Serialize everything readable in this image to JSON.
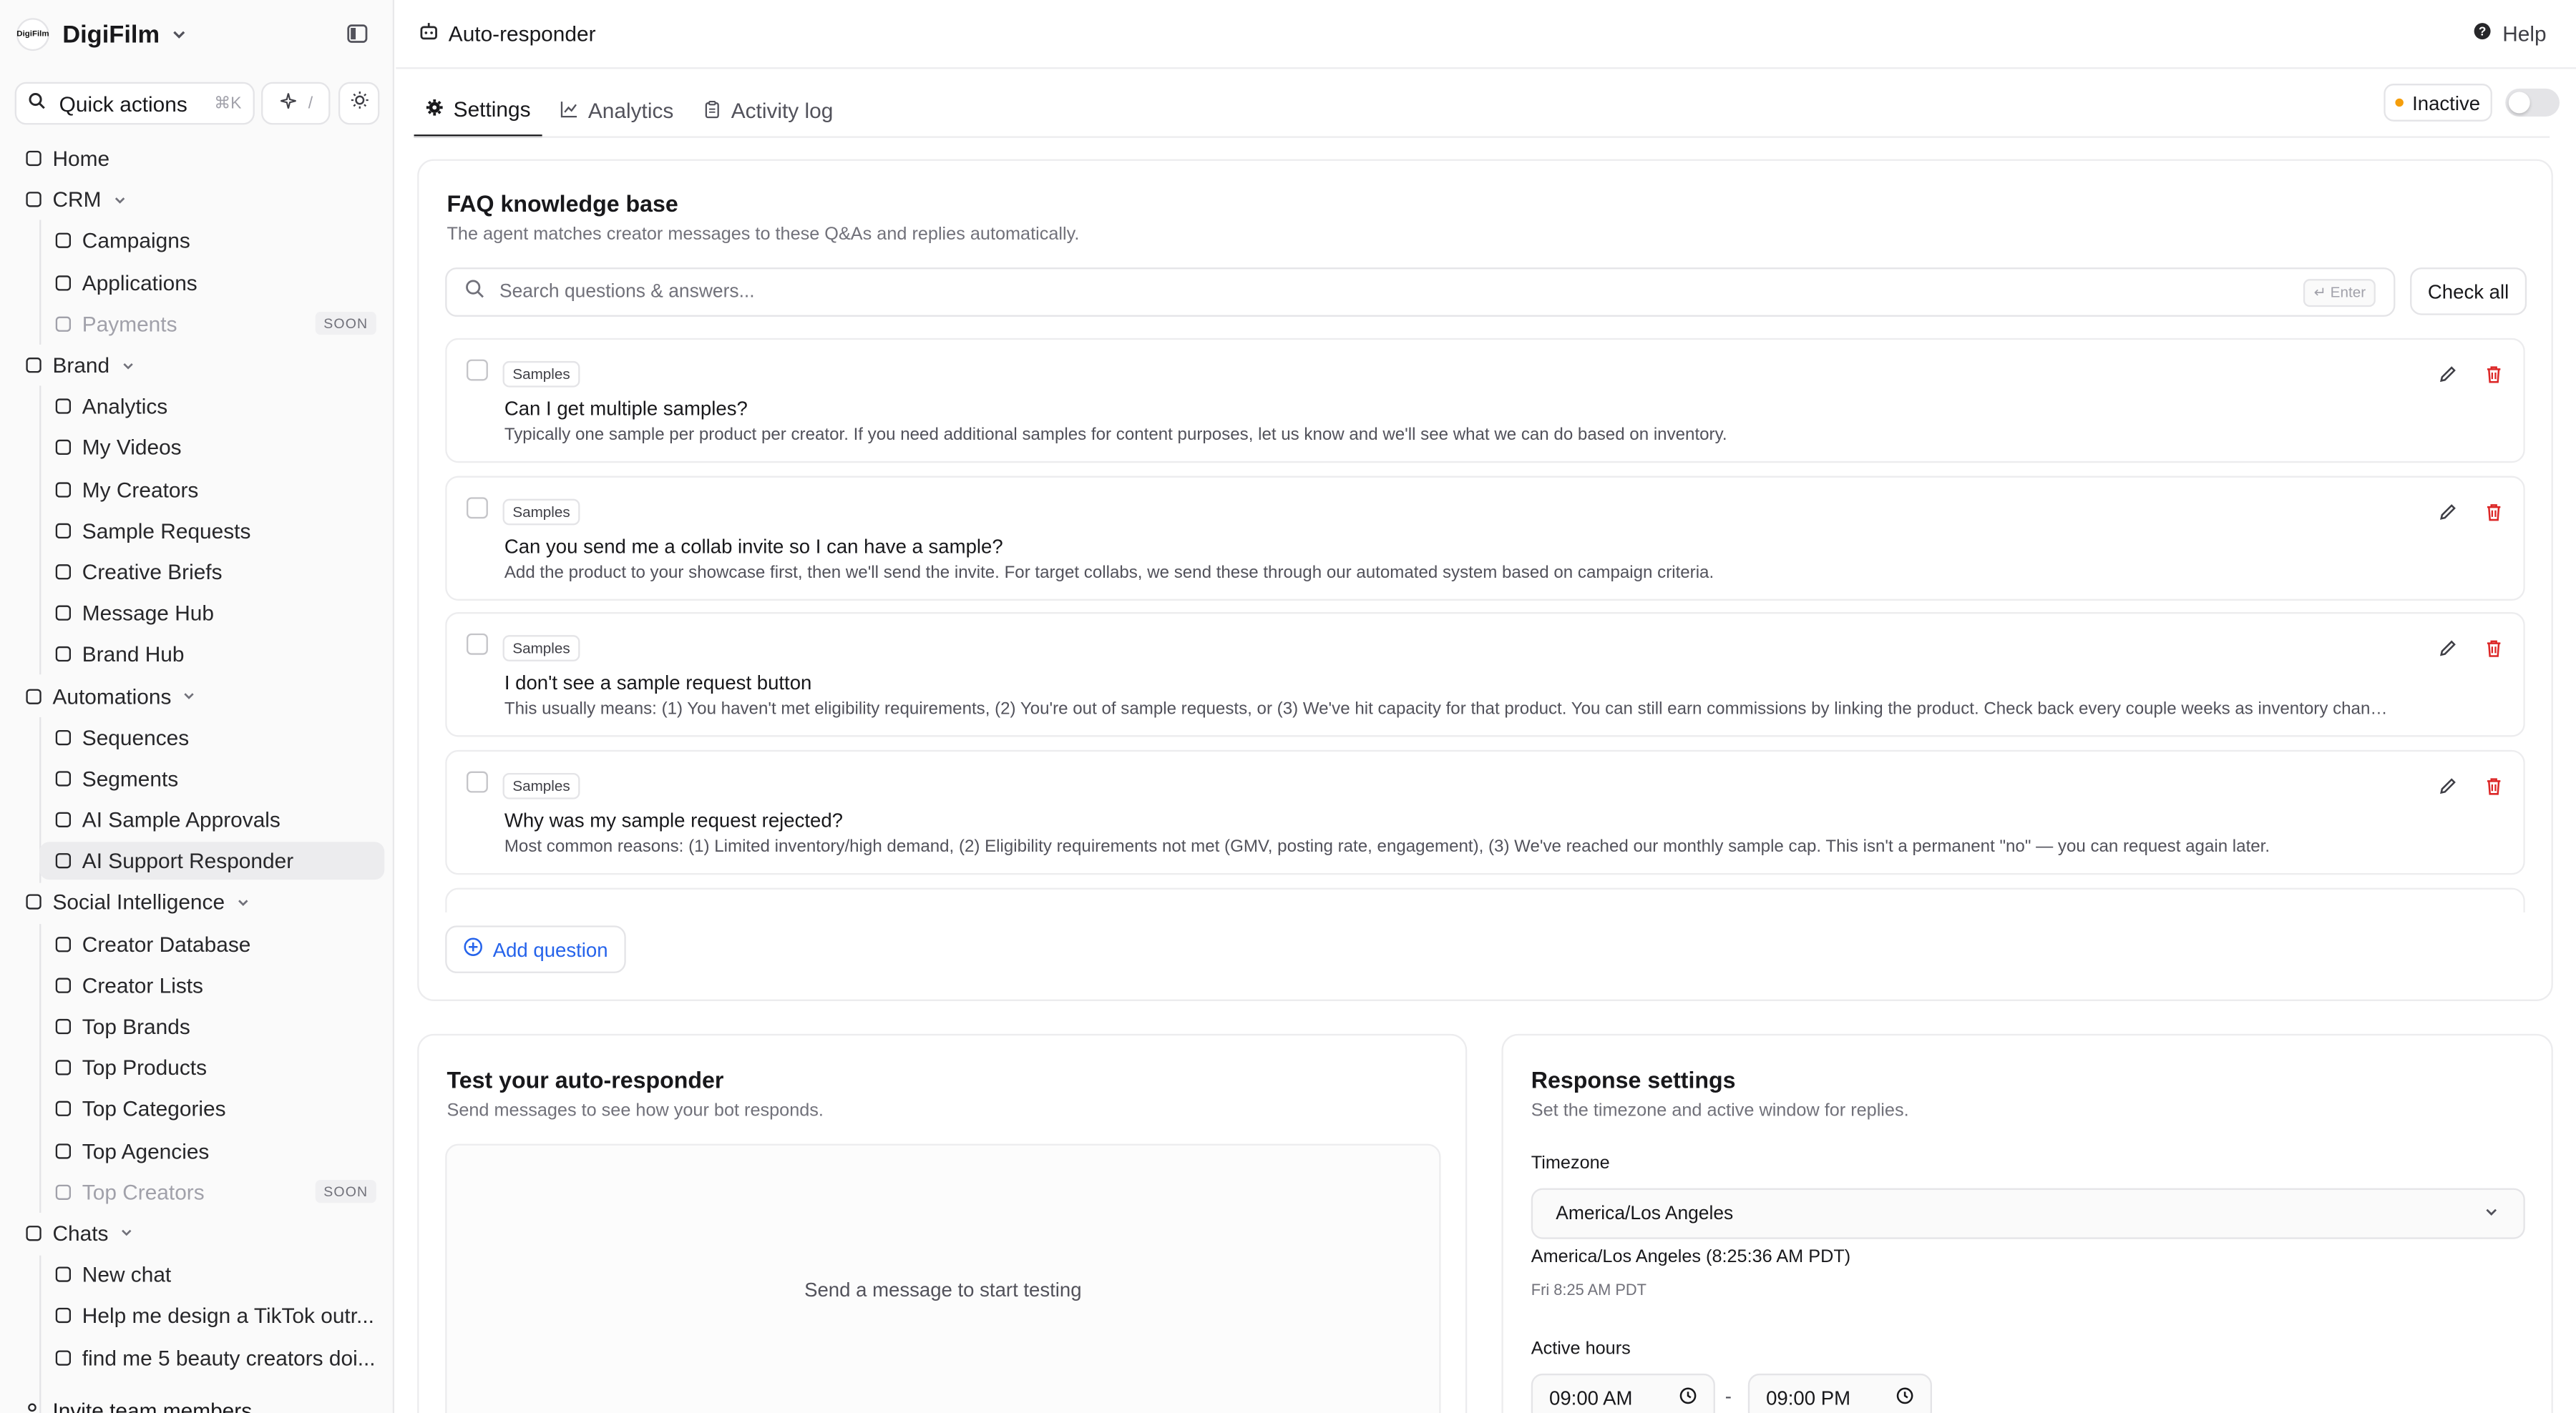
{
  "sidebar": {
    "logo_text": "DigiFilm",
    "brand": "DigiFilm",
    "quick_actions": {
      "label": "Quick actions",
      "shortcut": "⌘K",
      "slash": "/"
    },
    "nav": [
      {
        "label": "Home",
        "level": "top",
        "icon": "home-icon"
      },
      {
        "label": "CRM",
        "level": "top",
        "icon": "crm-icon",
        "chevron": true
      },
      {
        "label": "Campaigns",
        "level": "sub",
        "icon": "megaphone-icon"
      },
      {
        "label": "Applications",
        "level": "sub",
        "icon": "clipboard-icon"
      },
      {
        "label": "Payments",
        "level": "sub",
        "icon": "credit-card-icon",
        "badge": "SOON",
        "disabled": true
      },
      {
        "label": "Brand",
        "level": "top",
        "icon": "book-icon",
        "chevron": true
      },
      {
        "label": "Analytics",
        "level": "sub",
        "icon": "chart-line-icon"
      },
      {
        "label": "My Videos",
        "level": "sub",
        "icon": "video-icon"
      },
      {
        "label": "My Creators",
        "level": "sub",
        "icon": "users-icon"
      },
      {
        "label": "Sample Requests",
        "level": "sub",
        "icon": "gift-icon"
      },
      {
        "label": "Creative Briefs",
        "level": "sub",
        "icon": "file-icon"
      },
      {
        "label": "Message Hub",
        "level": "sub",
        "icon": "message-icon"
      },
      {
        "label": "Brand Hub",
        "level": "sub",
        "icon": "database-icon"
      },
      {
        "label": "Automations",
        "level": "top",
        "icon": "zap-icon",
        "chevron": true
      },
      {
        "label": "Sequences",
        "level": "sub",
        "icon": "send-icon"
      },
      {
        "label": "Segments",
        "level": "sub",
        "icon": "filter-icon"
      },
      {
        "label": "AI Sample Approvals",
        "level": "sub",
        "icon": "package-icon"
      },
      {
        "label": "AI Support Responder",
        "level": "sub",
        "icon": "bot-icon",
        "active": true
      },
      {
        "label": "Social Intelligence",
        "level": "top",
        "icon": "trending-icon",
        "chevron": true
      },
      {
        "label": "Creator Database",
        "level": "sub",
        "icon": "user-search-icon"
      },
      {
        "label": "Creator Lists",
        "level": "sub",
        "icon": "list-icon"
      },
      {
        "label": "Top Brands",
        "level": "sub",
        "icon": "store-icon"
      },
      {
        "label": "Top Products",
        "level": "sub",
        "icon": "bag-icon"
      },
      {
        "label": "Top Categories",
        "level": "sub",
        "icon": "layers-icon"
      },
      {
        "label": "Top Agencies",
        "level": "sub",
        "icon": "building-icon"
      },
      {
        "label": "Top Creators",
        "level": "sub",
        "icon": "bulb-icon",
        "badge": "SOON",
        "disabled": true
      },
      {
        "label": "Chats",
        "level": "top",
        "icon": "chats-icon",
        "chevron": true
      },
      {
        "label": "New chat",
        "level": "sub",
        "icon": "plus-icon"
      },
      {
        "label": "Help me design a TikTok outr...",
        "level": "sub",
        "icon": "message-icon"
      },
      {
        "label": "find me 5 beauty creators doi...",
        "level": "sub",
        "icon": "message-icon"
      }
    ],
    "invite": "Invite team members"
  },
  "header": {
    "title": "Auto-responder",
    "help": "Help"
  },
  "tabs": [
    {
      "label": "Settings",
      "icon": "gear-icon",
      "active": true
    },
    {
      "label": "Analytics",
      "icon": "chart-line-icon"
    },
    {
      "label": "Activity log",
      "icon": "clipboard-icon"
    }
  ],
  "status": {
    "label": "Inactive",
    "dot_color": "#f59e0b",
    "enabled": false
  },
  "faq": {
    "title": "FAQ knowledge base",
    "subtitle": "The agent matches creator messages to these Q&As and replies automatically.",
    "search_placeholder": "Search questions & answers...",
    "enter_hint": "↵ Enter",
    "check_all": "Check all",
    "items": [
      {
        "category": "Samples",
        "question": "Can I get multiple samples?",
        "answer": "Typically one sample per product per creator. If you need additional samples for content purposes, let us know and we'll see what we can do based on inventory."
      },
      {
        "category": "Samples",
        "question": "Can you send me a collab invite so I can have a sample?",
        "answer": "Add the product to your showcase first, then we'll send the invite. For target collabs, we send these through our automated system based on campaign criteria."
      },
      {
        "category": "Samples",
        "question": "I don't see a sample request button",
        "answer": "This usually means: (1) You haven't met eligibility requirements, (2) You're out of sample requests, or (3) We've hit capacity for that product. You can still earn commissions by linking the product. Check back every couple weeks as inventory changes."
      },
      {
        "category": "Samples",
        "question": "Why was my sample request rejected?",
        "answer": "Most common reasons: (1) Limited inventory/high demand, (2) Eligibility requirements not met (GMV, posting rate, engagement), (3) We've reached our monthly sample cap. This isn't a permanent \"no\" — you can request again later."
      }
    ],
    "add_question": "Add question"
  },
  "test": {
    "title": "Test your auto-responder",
    "subtitle": "Send messages to see how your bot responds.",
    "placeholder": "Send a message to start testing"
  },
  "response": {
    "title": "Response settings",
    "subtitle": "Set the timezone and active window for replies.",
    "timezone_label": "Timezone",
    "timezone_value": "America/Los Angeles",
    "timezone_now": "America/Los Angeles (8:25:36 AM PDT)",
    "timezone_sub": "Fri 8:25 AM PDT",
    "active_hours_label": "Active hours",
    "start": "09:00 AM",
    "separator": "-",
    "end": "09:00 PM"
  }
}
